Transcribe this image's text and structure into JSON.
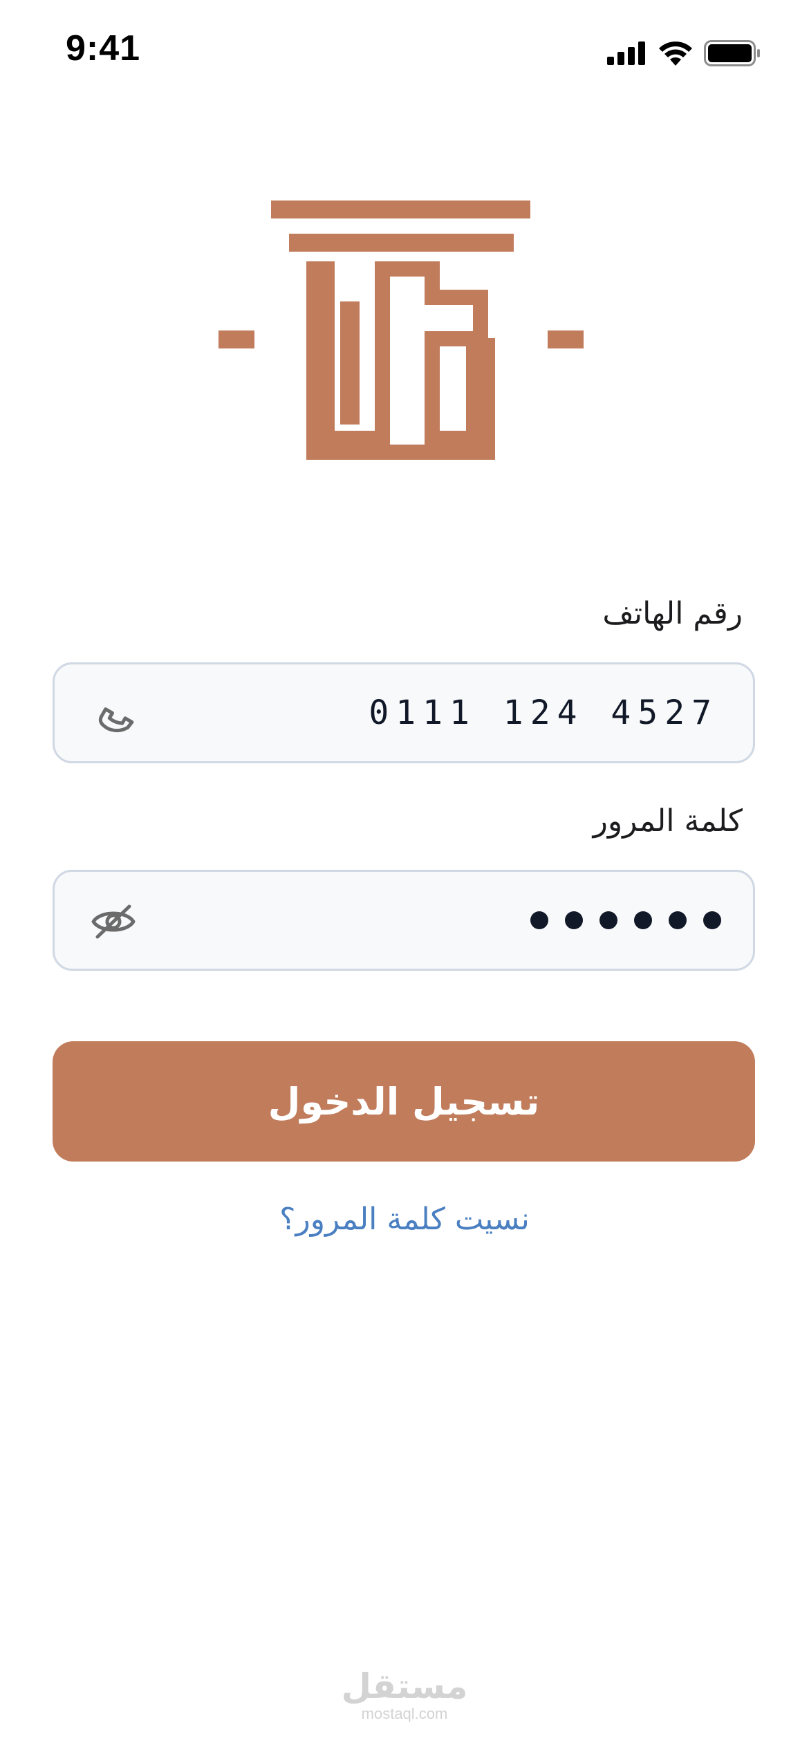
{
  "status_bar": {
    "time": "9:41",
    "icons": [
      "signal-icon",
      "wifi-icon",
      "battery-icon"
    ]
  },
  "logo": {
    "name": "olf-logo",
    "color": "#c17c5b"
  },
  "form": {
    "phone": {
      "label": "رقم الهاتف",
      "value": "0111 124 4527",
      "icon": "phone-icon"
    },
    "password": {
      "label": "كلمة المرور",
      "masked_length": 6,
      "icon": "eye-off-icon"
    }
  },
  "login_button": {
    "label": "تسجيل الدخول",
    "color": "#c17c5b"
  },
  "forgot_password": {
    "label": "نسيت كلمة المرور؟",
    "color": "#4a7fc1"
  },
  "watermark": {
    "ar": "مستقل",
    "en": "mostaql.com"
  }
}
